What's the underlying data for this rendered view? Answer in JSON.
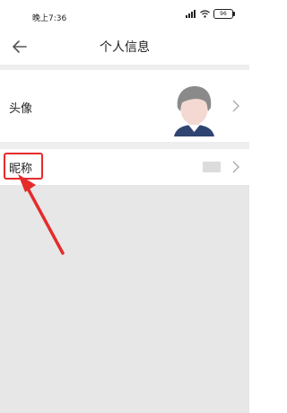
{
  "status_bar": {
    "time": "晚上7:36",
    "signal": "‰ıl",
    "wifi": "wifi",
    "battery": "96"
  },
  "header": {
    "title": "个人信息"
  },
  "rows": {
    "avatar": {
      "label": "头像"
    },
    "nickname": {
      "label": "昵称"
    }
  },
  "colors": {
    "highlight": "#e52b2b",
    "separator": "#eeeeee",
    "background_area": "#e7e7e7"
  },
  "icons": {
    "back": "arrow-left-icon",
    "chevron": "chevron-right-icon",
    "avatar": "default-avatar-icon",
    "annotation": "red-arrow-icon"
  }
}
